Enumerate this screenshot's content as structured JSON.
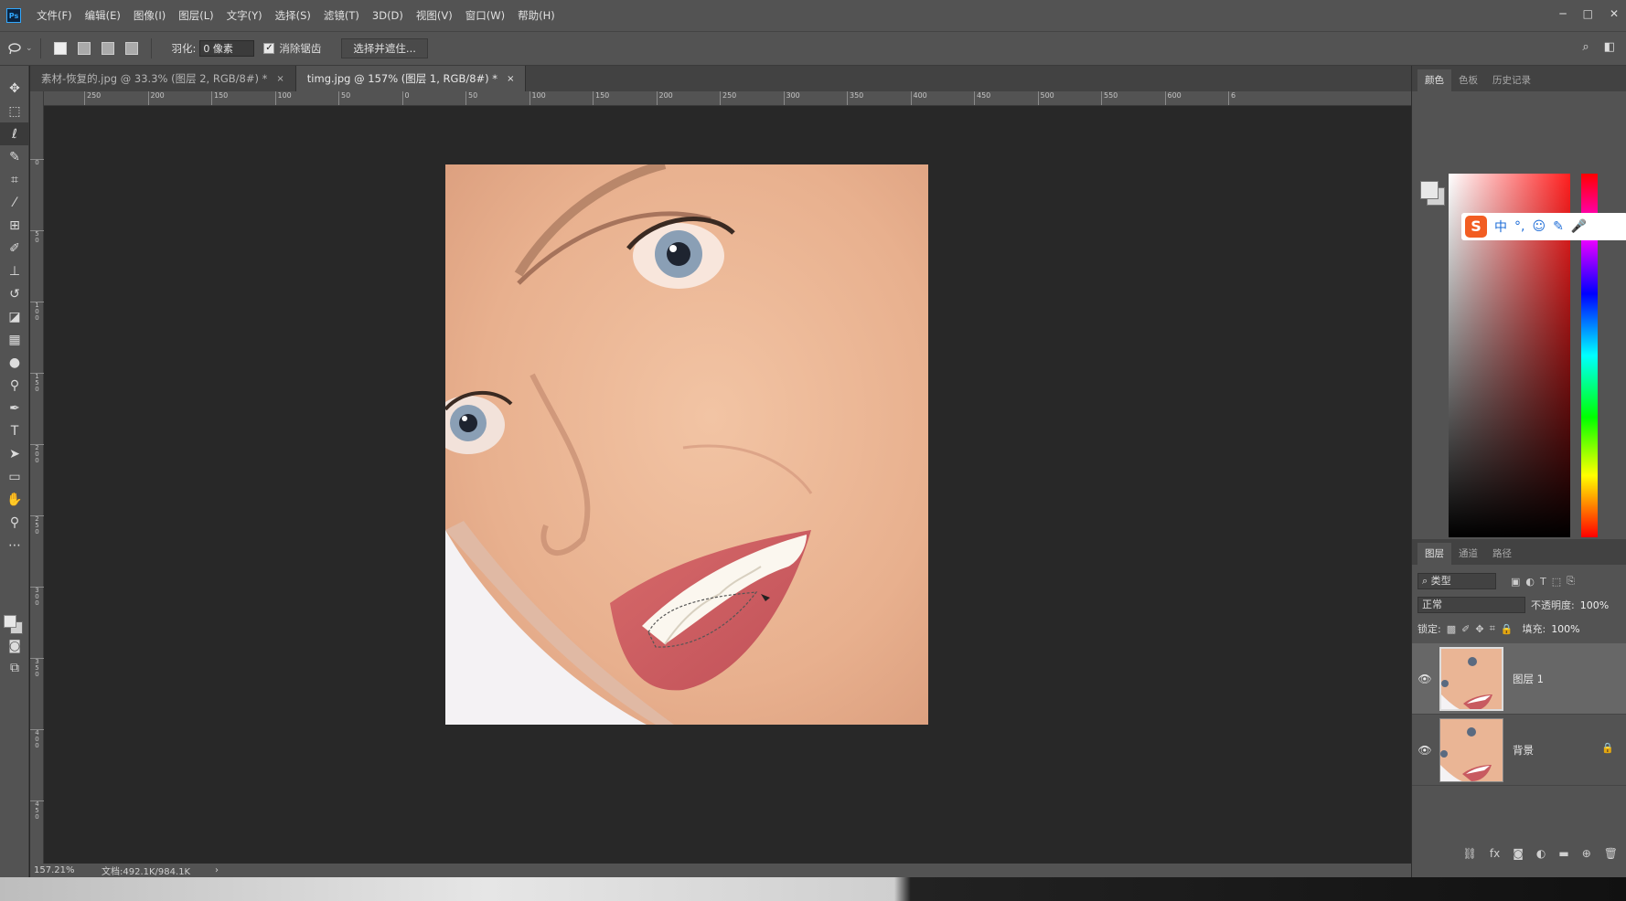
{
  "app": {
    "logo": "Ps"
  },
  "menu": [
    "文件(F)",
    "编辑(E)",
    "图像(I)",
    "图层(L)",
    "文字(Y)",
    "选择(S)",
    "滤镜(T)",
    "3D(D)",
    "视图(V)",
    "窗口(W)",
    "帮助(H)"
  ],
  "options": {
    "feather_label": "羽化:",
    "feather_value": "0 像素",
    "antialias_label": "消除锯齿",
    "antialias_checked": true,
    "select_mask_button": "选择并遮住..."
  },
  "tabs": [
    {
      "label": "素材-恢复的.jpg @ 33.3% (图层 2, RGB/8#) *",
      "close": "×"
    },
    {
      "label": "timg.jpg @ 157% (图层 1, RGB/8#) *",
      "close": "×"
    }
  ],
  "ruler_h": [
    "250",
    "200",
    "150",
    "100",
    "50",
    "0",
    "50",
    "100",
    "150",
    "200",
    "250",
    "300",
    "350",
    "400",
    "450",
    "500",
    "550",
    "600",
    "6"
  ],
  "ruler_v": [
    "0",
    "5 0",
    "1 0 0",
    "1 5 0",
    "2 0 0",
    "2 5 0",
    "3 0 0",
    "3 5 0",
    "4 0 0",
    "4 5 0"
  ],
  "status": {
    "zoom": "157.21%",
    "doc": "文档:492.1K/984.1K",
    "arrow": "›"
  },
  "color_panel": {
    "tabs": [
      "颜色",
      "色板",
      "历史记录"
    ],
    "fg_color": "#e8e8e8",
    "bg_color": "#d2d2d2",
    "ime": {
      "logo": "S",
      "cn": "中",
      "punct": "°,"
    }
  },
  "layers_panel": {
    "tabs": [
      "图层",
      "通道",
      "路径"
    ],
    "filter_label": "类型",
    "blend_mode": "正常",
    "opacity_label": "不透明度:",
    "opacity_value": "100%",
    "lock_label": "锁定:",
    "fill_label": "填充:",
    "fill_value": "100%",
    "layers": [
      {
        "name": "图层 1",
        "visible": true,
        "selected": true,
        "locked": false
      },
      {
        "name": "背景",
        "visible": true,
        "selected": false,
        "locked": true
      }
    ]
  }
}
